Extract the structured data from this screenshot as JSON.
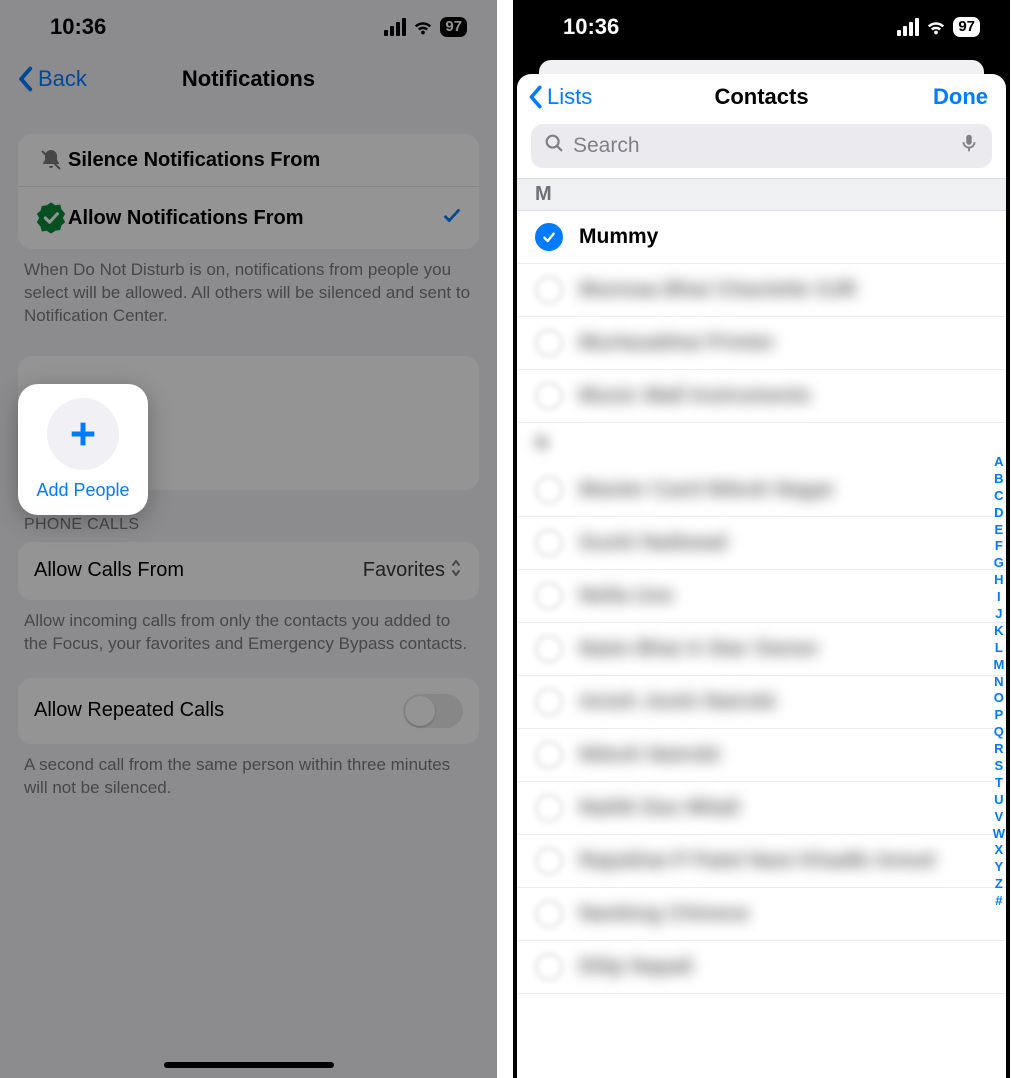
{
  "status": {
    "time": "10:36",
    "battery": "97"
  },
  "left": {
    "back_label": "Back",
    "title": "Notifications",
    "option_silence": "Silence Notifications From",
    "option_allow": "Allow Notifications From",
    "allow_desc": "When Do Not Disturb is on, notifications from people you select will be allowed. All others will be silenced and sent to Notification Center.",
    "add_people": "Add People",
    "phone_calls_header": "PHONE CALLS",
    "allow_calls_label": "Allow Calls From",
    "allow_calls_value": "Favorites",
    "calls_desc": "Allow incoming calls from only the contacts you added to the Focus, your favorites and Emergency Bypass contacts.",
    "repeated_label": "Allow Repeated Calls",
    "repeated_desc": "A second call from the same person within three minutes will not be silenced."
  },
  "right": {
    "lists_label": "Lists",
    "title": "Contacts",
    "done_label": "Done",
    "search_placeholder": "Search",
    "section_letter": "M",
    "selected_contact": "Mummy",
    "blurred_m": [
      "Munnaa Bhai Chaclette SJR",
      "Murtazabhai Printer",
      "Music Mall Instruments"
    ],
    "blurred_n_header": "N",
    "blurred_n": [
      "Master Card Nilesh Nagar",
      "Sushi Naikwad",
      "Nella Uve",
      "Naim Bhai A Star Owner",
      "Anish Joshi Nairobi",
      "Nilesh Nairobi",
      "Naitik Das Mitali",
      "Rajubhai P Patel Nani Khadki Amod",
      "Nanking Chinese",
      "Dilip Napali"
    ],
    "index": [
      "A",
      "B",
      "C",
      "D",
      "E",
      "F",
      "G",
      "H",
      "I",
      "J",
      "K",
      "L",
      "M",
      "N",
      "O",
      "P",
      "Q",
      "R",
      "S",
      "T",
      "U",
      "V",
      "W",
      "X",
      "Y",
      "Z",
      "#"
    ]
  }
}
